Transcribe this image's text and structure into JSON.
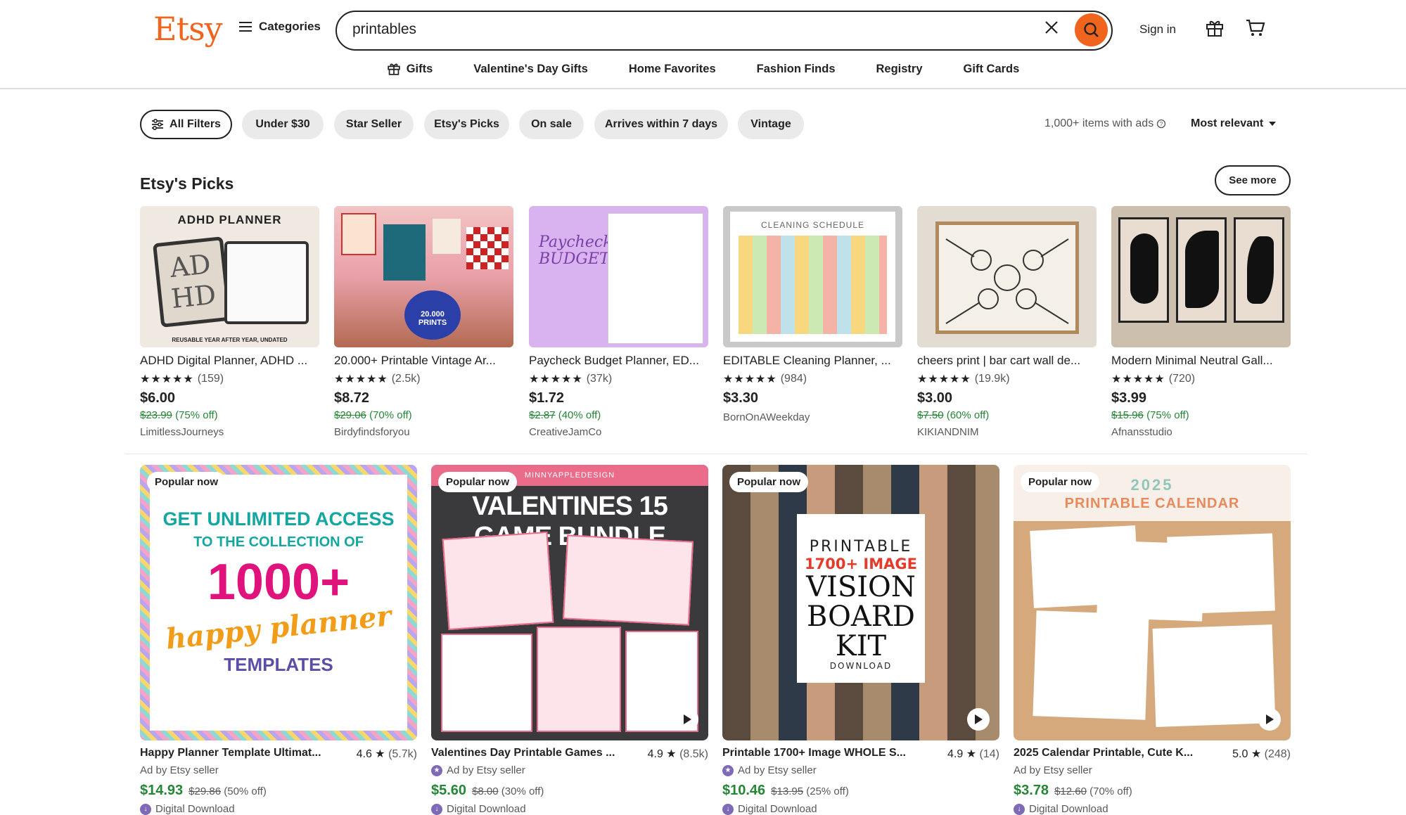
{
  "header": {
    "logo": "Etsy",
    "categories_label": "Categories",
    "search_value": "printables",
    "sign_in": "Sign in"
  },
  "nav": [
    "Gifts",
    "Valentine's Day Gifts",
    "Home Favorites",
    "Fashion Finds",
    "Registry",
    "Gift Cards"
  ],
  "filters": {
    "all": "All Filters",
    "chips": [
      "Under $30",
      "Star Seller",
      "Etsy's Picks",
      "On sale",
      "Arrives within 7 days",
      "Vintage"
    ],
    "results": "1,000+ items with ads",
    "sort": "Most relevant"
  },
  "picks": {
    "title": "Etsy's Picks",
    "see_more": "See more",
    "items": [
      {
        "title": "ADHD Digital Planner, ADHD ...",
        "stars": "★★★★★",
        "count": "(159)",
        "price": "$6.00",
        "orig": "$23.99",
        "discount": "(75% off)",
        "shop": "LimitlessJourneys",
        "img_text": "ADHD PLANNER"
      },
      {
        "title": "20.000+ Printable Vintage Ar...",
        "stars": "★★★★★",
        "count": "(2.5k)",
        "price": "$8.72",
        "orig": "$29.06",
        "discount": "(70% off)",
        "shop": "Birdyfindsforyou",
        "img_text": "20.000 PRINTS"
      },
      {
        "title": "Paycheck Budget Planner, ED...",
        "stars": "★★★★★",
        "count": "(37k)",
        "price": "$1.72",
        "orig": "$2.87",
        "discount": "(40% off)",
        "shop": "CreativeJamCo",
        "img_text": "Paycheck BUDGET"
      },
      {
        "title": "EDITABLE Cleaning Planner, ...",
        "stars": "★★★★★",
        "count": "(984)",
        "price": "$3.30",
        "orig": "",
        "discount": "",
        "shop": "BornOnAWeekday",
        "img_text": "CLEANING SCHEDULE"
      },
      {
        "title": "cheers print | bar cart wall de...",
        "stars": "★★★★★",
        "count": "(19.9k)",
        "price": "$3.00",
        "orig": "$7.50",
        "discount": "(60% off)",
        "shop": "KIKIANDNIM",
        "img_text": ""
      },
      {
        "title": "Modern Minimal Neutral Gall...",
        "stars": "★★★★★",
        "count": "(720)",
        "price": "$3.99",
        "orig": "$15.96",
        "discount": "(75% off)",
        "shop": "Afnansstudio",
        "img_text": ""
      }
    ]
  },
  "cards": [
    {
      "badge": "Popular now",
      "title": "Happy Planner Template Ultimat...",
      "rating": "4.6",
      "count": "(5.7k)",
      "ad": "Ad by Etsy seller",
      "price": "$14.93",
      "orig": "$29.86",
      "discount": "(50% off)",
      "dd": "Digital Download",
      "img_line1": "GET UNLIMITED ACCESS",
      "img_line2": "TO THE COLLECTION OF",
      "img_big": "1000+",
      "img_script": "happy planner",
      "img_line3": "TEMPLATES"
    },
    {
      "badge": "Popular now",
      "title": "Valentines Day Printable Games ...",
      "rating": "4.9",
      "count": "(8.5k)",
      "ad": "Ad by Etsy seller",
      "price": "$5.60",
      "orig": "$8.00",
      "discount": "(30% off)",
      "dd": "Digital Download",
      "img_top": "MINNYAPPLEDESIGN",
      "img_title": "VALENTINES 15 GAME BUNDLE"
    },
    {
      "badge": "Popular now",
      "title": "Printable 1700+ Image WHOLE S...",
      "rating": "4.9",
      "count": "(14)",
      "ad": "Ad by Etsy seller",
      "price": "$10.46",
      "orig": "$13.95",
      "discount": "(25% off)",
      "dd": "Digital Download",
      "img_l1": "PRINTABLE",
      "img_l2": "1700+ IMAGE",
      "img_l3": "VISION",
      "img_l4": "BOARD",
      "img_l5": "KIT",
      "img_l6": "DOWNLOAD"
    },
    {
      "badge": "Popular now",
      "title": "2025 Calendar Printable, Cute K...",
      "rating": "5.0",
      "count": "(248)",
      "ad": "Ad by Etsy seller",
      "price": "$3.78",
      "orig": "$12.60",
      "discount": "(70% off)",
      "dd": "Digital Download",
      "img_l1": "2025",
      "img_l2": "PRINTABLE CALENDAR"
    }
  ],
  "colors": {
    "brand": "#f1641e",
    "sale": "#258635"
  }
}
